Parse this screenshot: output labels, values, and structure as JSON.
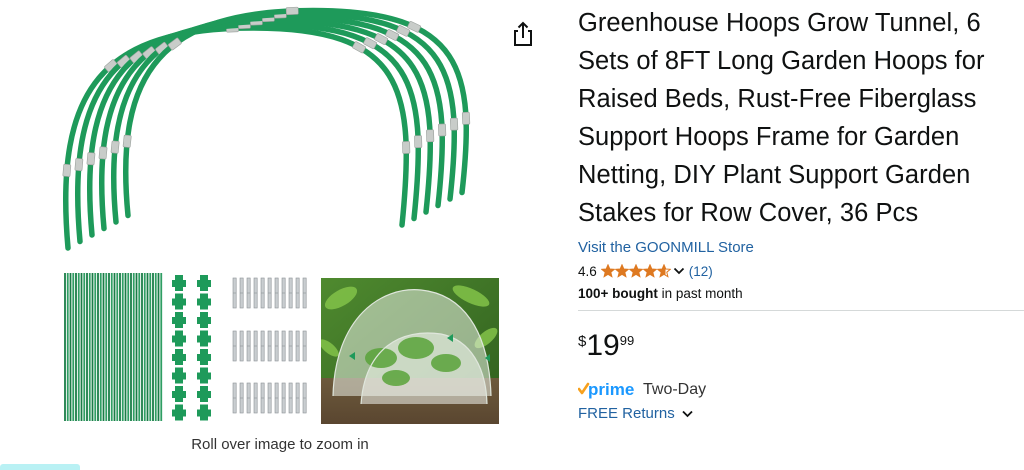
{
  "gallery": {
    "zoom_hint": "Roll over image to zoom in",
    "hero_image_icon": "greenhouse-hoops-icon",
    "parts_image_icon": "hoop-parts-icon",
    "photo_icon": "row-cover-tunnel-photo",
    "colors": {
      "hoop_green": "#1e9a5a",
      "sleeve_gray": "#c8ccc9"
    }
  },
  "share": {
    "icon": "share-icon"
  },
  "product": {
    "title": "Greenhouse Hoops Grow Tunnel, 6 Sets of 8FT Long Garden Hoops for Raised Beds, Rust-Free Fiberglass Support Hoops Frame for Garden Netting, DIY Plant Support Garden Stakes for Row Cover, 36 Pcs",
    "store_link": "Visit the GOONMILL Store",
    "rating": {
      "value": "4.6",
      "stars": 4.6,
      "count": "(12)"
    },
    "bought_bold": "100+ bought",
    "bought_rest": " in past month",
    "price": {
      "symbol": "$",
      "whole": "19",
      "fraction": "99"
    },
    "prime": {
      "label": "prime",
      "delivery": "Two-Day"
    },
    "returns": "FREE Returns"
  },
  "colors": {
    "link": "#2162a1",
    "star": "#de7921",
    "prime_blue": "#1a98ff",
    "prime_check": "#f7a11e",
    "divider": "#d5d9d9"
  }
}
